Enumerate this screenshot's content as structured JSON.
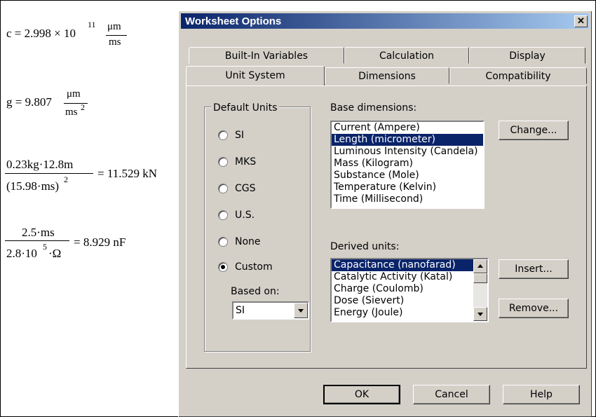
{
  "worksheet": {
    "eq_c": {
      "lhs": "c = 2.998 × 10",
      "exp": "11",
      "num": "μm",
      "den": "ms"
    },
    "eq_g": {
      "lhs": "g = 9.807",
      "num": "μm",
      "den": "ms",
      "exp": "2"
    },
    "eq_force": {
      "num": "0.23kg·12.8m",
      "den": "(15.98·ms)",
      "exp": "2",
      "result": "= 11.529 kN"
    },
    "eq_cap": {
      "num": "2.5·ms",
      "den_a": "2.8·10",
      "exp": "5",
      "den_b": "·Ω",
      "result": "= 8.929 nF"
    }
  },
  "dialog": {
    "title": "Worksheet Options",
    "close_label": "✕",
    "tabs_back": [
      "Built-In Variables",
      "Calculation",
      "Display"
    ],
    "tabs_front": [
      "Unit System",
      "Dimensions",
      "Compatibility"
    ],
    "active_tab": "Unit System",
    "default_units": {
      "label": "Default Units",
      "options": [
        "SI",
        "MKS",
        "CGS",
        "U.S.",
        "None",
        "Custom"
      ],
      "selected": "Custom",
      "based_on_label": "Based on:",
      "based_on_value": "SI"
    },
    "base_dimensions": {
      "label": "Base dimensions:",
      "items": [
        "Current (Ampere)",
        "Length (micrometer)",
        "Luminous Intensity (Candela)",
        "Mass (Kilogram)",
        "Substance (Mole)",
        "Temperature (Kelvin)",
        "Time (Millisecond)"
      ],
      "selected": "Length (micrometer)",
      "change_button": "Change..."
    },
    "derived_units": {
      "label": "Derived units:",
      "items": [
        "Capacitance (nanofarad)",
        "Catalytic Activity (Katal)",
        "Charge (Coulomb)",
        "Dose (Sievert)",
        "Energy (Joule)"
      ],
      "selected": "Capacitance (nanofarad)",
      "insert_button": "Insert...",
      "remove_button": "Remove..."
    },
    "buttons": {
      "ok": "OK",
      "cancel": "Cancel",
      "help": "Help"
    },
    "colors": {
      "title_start": "#0a246a",
      "title_end": "#a6caf0",
      "face": "#d4d0c8",
      "selection": "#0a246a"
    }
  }
}
